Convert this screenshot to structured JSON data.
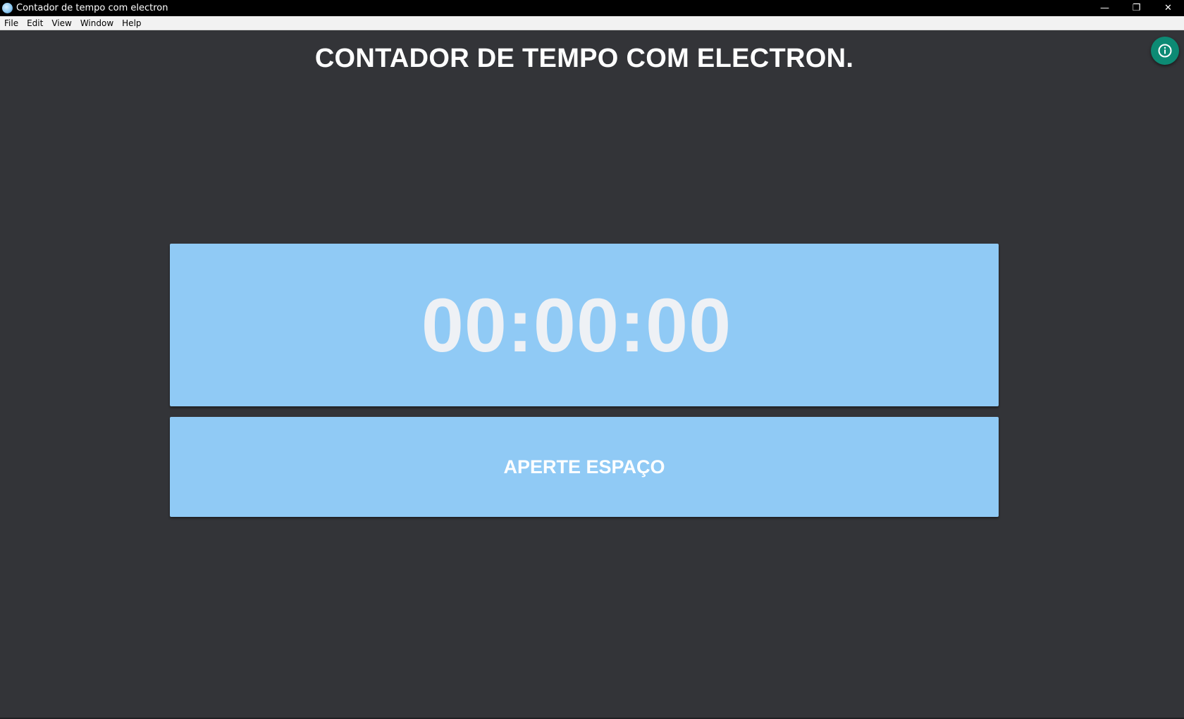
{
  "window": {
    "title": "Contador de tempo com electron",
    "controls": {
      "minimize": "—",
      "restore": "❐",
      "close": "✕"
    }
  },
  "menu": {
    "items": [
      "File",
      "Edit",
      "View",
      "Window",
      "Help"
    ]
  },
  "page": {
    "title": "CONTADOR DE TEMPO COM ELECTRON.",
    "timer": "00:00:00",
    "action_label": "APERTE ESPAÇO"
  },
  "colors": {
    "background": "#333438",
    "card": "#90caf5",
    "info_button": "#0d8a74",
    "timer_text": "#eef1f5"
  },
  "icons": {
    "app": "electron-app-icon",
    "info": "info-icon"
  }
}
